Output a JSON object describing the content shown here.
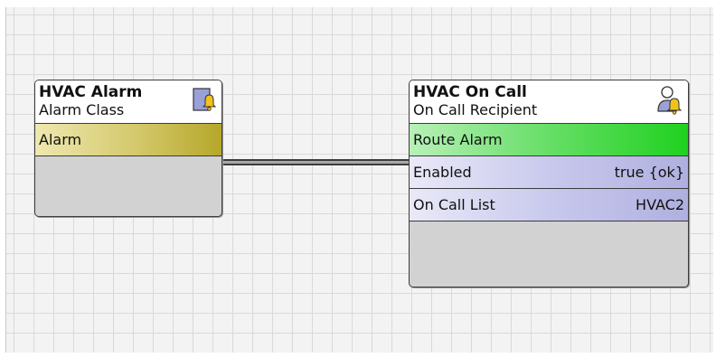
{
  "nodes": {
    "alarm_class": {
      "title": "HVAC Alarm",
      "type": "Alarm Class",
      "icon": "alarm-class-bell-icon",
      "slots": [
        {
          "label": "Alarm",
          "value": ""
        }
      ]
    },
    "on_call": {
      "title": "HVAC On Call",
      "type": "On Call Recipient",
      "icon": "on-call-person-bell-icon",
      "slots": [
        {
          "label": "Route Alarm",
          "value": ""
        },
        {
          "label": "Enabled",
          "value": "true {ok}"
        },
        {
          "label": "On Call List",
          "value": "HVAC2"
        }
      ]
    }
  },
  "colors": {
    "alarm_slot": "#c9bc4a",
    "route_slot": "#2ad42a",
    "property_slot": "#bcbce6",
    "grid_line": "#d9d9d9"
  }
}
